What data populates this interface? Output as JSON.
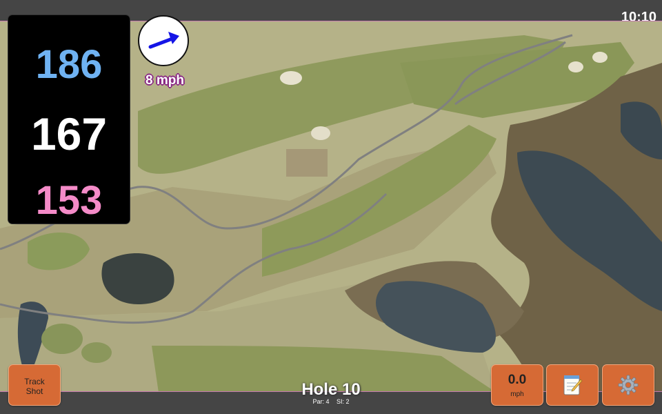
{
  "status": {
    "time": "10:10"
  },
  "yardages": {
    "back": "186",
    "middle": "167",
    "front": "153"
  },
  "wind": {
    "speed_label": "8 mph"
  },
  "hole": {
    "title": "Hole 10",
    "par": "Par: 4",
    "stroke_index": "SI: 2"
  },
  "buttons": {
    "track_shot": [
      "Track",
      "Shot"
    ],
    "wind_value": "0.0",
    "wind_unit": "mph"
  },
  "icons": {
    "wind_arrow": "arrow-icon",
    "notes": "notepad-icon",
    "settings": "gear-icon"
  },
  "colors": {
    "back": "#6fb2f2",
    "middle": "#ffffff",
    "front": "#f48bc8",
    "button": "#d66a35",
    "wind_arrow": "#1515e6"
  }
}
